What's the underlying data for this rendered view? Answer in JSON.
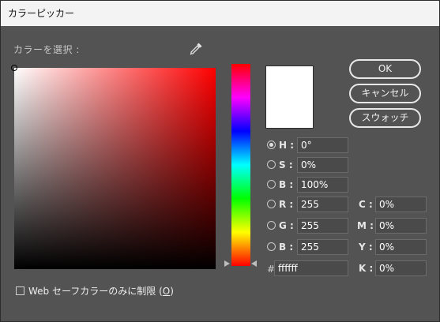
{
  "window": {
    "title": "カラーピッカー"
  },
  "picker": {
    "select_label": "カラーを選択 :",
    "eyedropper_icon": "eyedropper-icon",
    "current_color": "#ffffff"
  },
  "buttons": {
    "ok": "OK",
    "cancel": "キャンセル",
    "swatches": "スウォッチ"
  },
  "hsb": {
    "h": {
      "label": "H :",
      "value": "0°",
      "selected": true
    },
    "s": {
      "label": "S :",
      "value": "0%",
      "selected": false
    },
    "b": {
      "label": "B :",
      "value": "100%",
      "selected": false
    }
  },
  "rgb": {
    "r": {
      "label": "R :",
      "value": "255"
    },
    "g": {
      "label": "G :",
      "value": "255"
    },
    "b": {
      "label": "B :",
      "value": "255"
    }
  },
  "cmyk": {
    "c": {
      "label": "C :",
      "value": "0%"
    },
    "m": {
      "label": "M :",
      "value": "0%"
    },
    "y": {
      "label": "Y :",
      "value": "0%"
    },
    "k": {
      "label": "K :",
      "value": "0%"
    }
  },
  "hex": {
    "label": "#",
    "value": "ffffff"
  },
  "web_safe": {
    "label_before": "Web セーフカラーのみに制限 (",
    "mnemonic": "O",
    "label_after": ")",
    "checked": false
  }
}
